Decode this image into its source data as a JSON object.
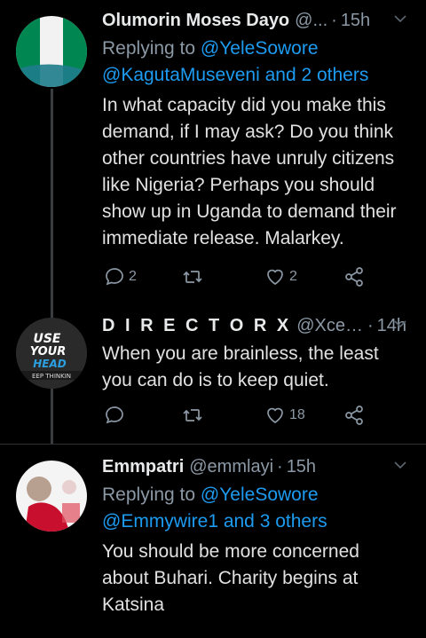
{
  "tweets": [
    {
      "name": "Olumorin Moses Dayo",
      "handle": "@...",
      "time": "15h",
      "reply_prefix": "Replying to",
      "reply_link1": "@YeleSowore",
      "reply_link2": "@KagutaMuseveni and 2 others",
      "body": "In what capacity did you make this demand, if I may ask? Do you think other countries have unruly citizens like Nigeria? Perhaps you should show up in Uganda to demand their immediate release. Malarkey.",
      "reply_count": "2",
      "retweet_count": "",
      "like_count": "2",
      "avatar": "nigeria-flag"
    },
    {
      "name": "D I R E C T O R  X",
      "handle": "@Xcell...",
      "time": "14h",
      "body": "When you are brainless, the least you can do is to keep quiet.",
      "reply_count": "",
      "retweet_count": "",
      "like_count": "18",
      "avatar_text1": "USE",
      "avatar_text2": "YOUR",
      "avatar_text3": "HEAD",
      "avatar_text4": "EEP THINKIN"
    },
    {
      "name": "Emmpatri",
      "handle": "@emmlayi",
      "time": "15h",
      "reply_prefix": "Replying to",
      "reply_link1": "@YeleSowore",
      "reply_link2": "@Emmywire1 and 3 others",
      "body": "You should be more concerned about Buhari. Charity begins at Katsina",
      "avatar": "footballer-photo"
    }
  ],
  "separator_dot": "·",
  "colors": {
    "background": "#000000",
    "link": "#1d9bf0",
    "muted": "#8b98a5",
    "divider": "#2f3336",
    "flag_green": "#008751"
  }
}
